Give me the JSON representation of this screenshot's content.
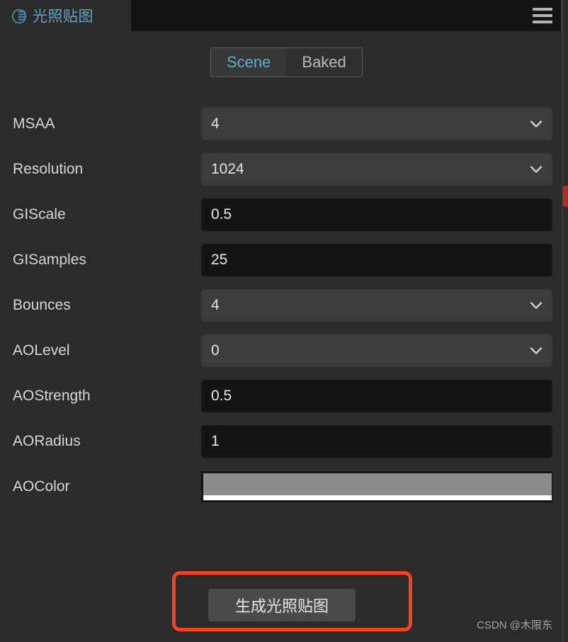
{
  "app": {
    "title": "光照贴图",
    "logo_icon": "lightmap-globe-icon",
    "menu_icon": "hamburger-menu-icon",
    "accent_color": "#61a6c4",
    "background_color": "#2b2b2b",
    "annotation_color": "#f4441e"
  },
  "tabs": [
    {
      "label": "Scene",
      "active": true
    },
    {
      "label": "Baked",
      "active": false
    }
  ],
  "fields": [
    {
      "label": "MSAA",
      "value": "4",
      "type": "select"
    },
    {
      "label": "Resolution",
      "value": "1024",
      "type": "select"
    },
    {
      "label": "GIScale",
      "value": "0.5",
      "type": "input"
    },
    {
      "label": "GISamples",
      "value": "25",
      "type": "input"
    },
    {
      "label": "Bounces",
      "value": "4",
      "type": "select"
    },
    {
      "label": "AOLevel",
      "value": "0",
      "type": "select"
    },
    {
      "label": "AOStrength",
      "value": "0.5",
      "type": "input"
    },
    {
      "label": "AORadius",
      "value": "1",
      "type": "input"
    },
    {
      "label": "AOColor",
      "value": "#8c8c8c",
      "type": "color"
    }
  ],
  "actions": {
    "generate_label": "生成光照贴图"
  },
  "watermark": "CSDN @木限东"
}
